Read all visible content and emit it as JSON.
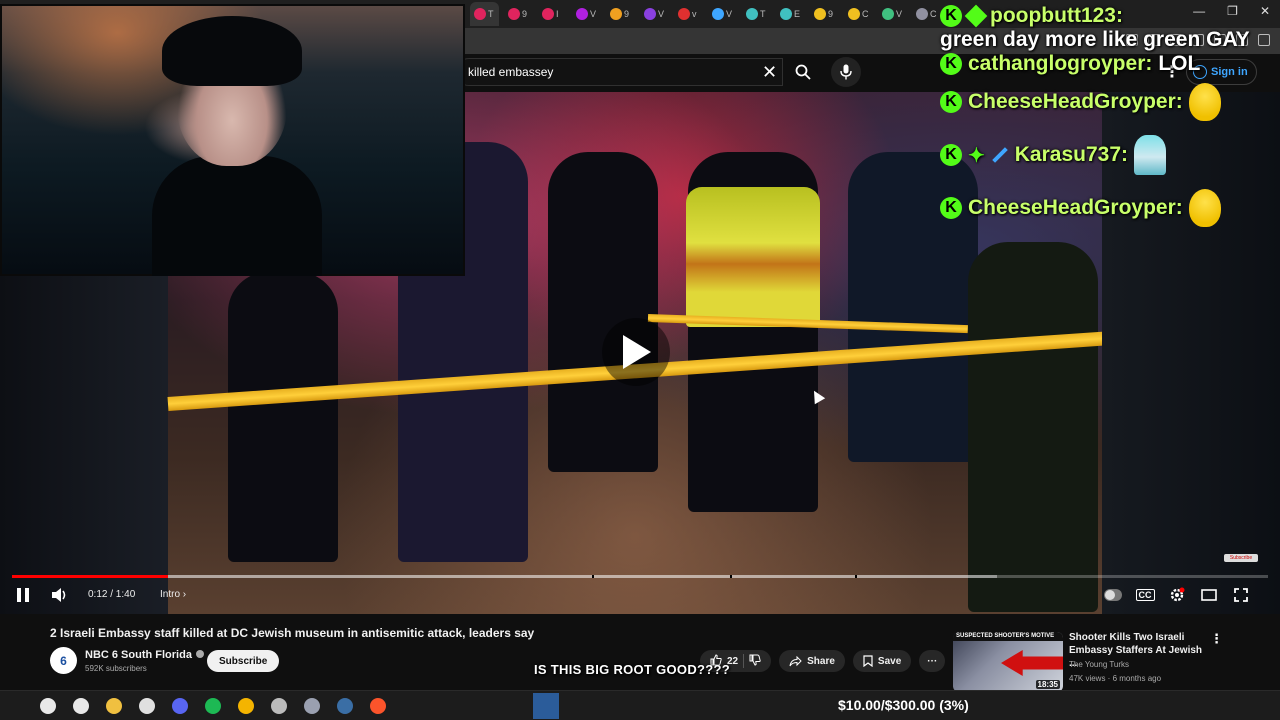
{
  "browser": {
    "tabs": [
      {
        "color": "#e0245e",
        "label": "T"
      },
      {
        "color": "#e0245e",
        "label": "9"
      },
      {
        "color": "#e0245e",
        "label": "I"
      },
      {
        "color": "#b020e0",
        "label": "V"
      },
      {
        "color": "#f0a020",
        "label": "9"
      },
      {
        "color": "#8a40e0",
        "label": "V"
      },
      {
        "color": "#e03030",
        "label": "v"
      },
      {
        "color": "#3ea6ff",
        "label": "V"
      },
      {
        "color": "#40c0c0",
        "label": "T"
      },
      {
        "color": "#40c0c0",
        "label": "E"
      },
      {
        "color": "#f0c020",
        "label": "9"
      },
      {
        "color": "#f0c020",
        "label": "C"
      },
      {
        "color": "#40c080",
        "label": "V"
      },
      {
        "color": "#9090a0",
        "label": "C"
      }
    ],
    "new_tab": "+",
    "window_controls": {
      "minimize": "—",
      "maximize": "❐",
      "close": "✕"
    }
  },
  "masthead": {
    "search_value": "killed embassey",
    "clear_icon": "✕",
    "more_icon": "⋮",
    "sign_in": "Sign in"
  },
  "player": {
    "time": "0:12 / 1:40",
    "chapter": "Intro",
    "progress_fraction": 0.124,
    "buffer_fraction": 0.784,
    "badge": "Subscribe",
    "cc": "CC",
    "settings_badge": "HD"
  },
  "facecam": {},
  "chat": [
    {
      "user": "poopbutt123:",
      "message": "",
      "badges": [
        "k-badge",
        "gem-badge"
      ]
    },
    {
      "user": "",
      "message": "green day more like green GAY",
      "badges": []
    },
    {
      "user": "cathanglogroyper:",
      "message": "LOL",
      "badges": [
        "k-badge"
      ]
    },
    {
      "user": "CheeseHeadGroyper:",
      "message": "",
      "badges": [
        "k-badge"
      ],
      "emote": "duck-emote"
    },
    {
      "user": "Karasu737:",
      "message": "",
      "badges": [
        "k-badge",
        "star-badge",
        "sword-badge"
      ],
      "emote": "miku-emote"
    },
    {
      "user": "CheeseHeadGroyper:",
      "message": "",
      "badges": [
        "k-badge"
      ],
      "emote": "duck-emote"
    }
  ],
  "video": {
    "title": "2 Israeli Embassy staff killed at DC Jewish museum in antisemitic attack, leaders say",
    "channel": "NBC 6 South Florida",
    "channel_avatar_text": "6",
    "subscribers": "592K subscribers",
    "subscribe": "Subscribe",
    "likes": "22",
    "share": "Share",
    "save": "Save",
    "more": "···"
  },
  "overlay_text": "IS THIS BIG ROOT GOOD????",
  "recommendation": {
    "banner": "SUSPECTED SHOOTER'S MOTIVE",
    "duration": "18:35",
    "title": "Shooter Kills Two Israeli Embassy Staffers At Jewish ...",
    "channel": "The Young Turks",
    "meta": "47K views · 6 months ago",
    "more": "⋮"
  },
  "taskbar": {
    "apps": [
      {
        "name": "search-icon",
        "color": "#e8e8e8"
      },
      {
        "name": "taskview-icon",
        "color": "#e8e8e8"
      },
      {
        "name": "folder-icon",
        "color": "#f0c040"
      },
      {
        "name": "app-icon-1",
        "color": "#e0e0e0"
      },
      {
        "name": "discord-icon",
        "color": "#5865f2"
      },
      {
        "name": "spotify-icon",
        "color": "#1db954"
      },
      {
        "name": "chrome-icon",
        "color": "#f4b400"
      },
      {
        "name": "app-icon-2",
        "color": "#bbbbbb"
      },
      {
        "name": "app-icon-3",
        "color": "#9aa0b0"
      },
      {
        "name": "steam-icon",
        "color": "#3a6ea5"
      },
      {
        "name": "brave-icon",
        "color": "#fb542b"
      }
    ],
    "donation_goal": "$10.00/$300.00 (3%)"
  }
}
